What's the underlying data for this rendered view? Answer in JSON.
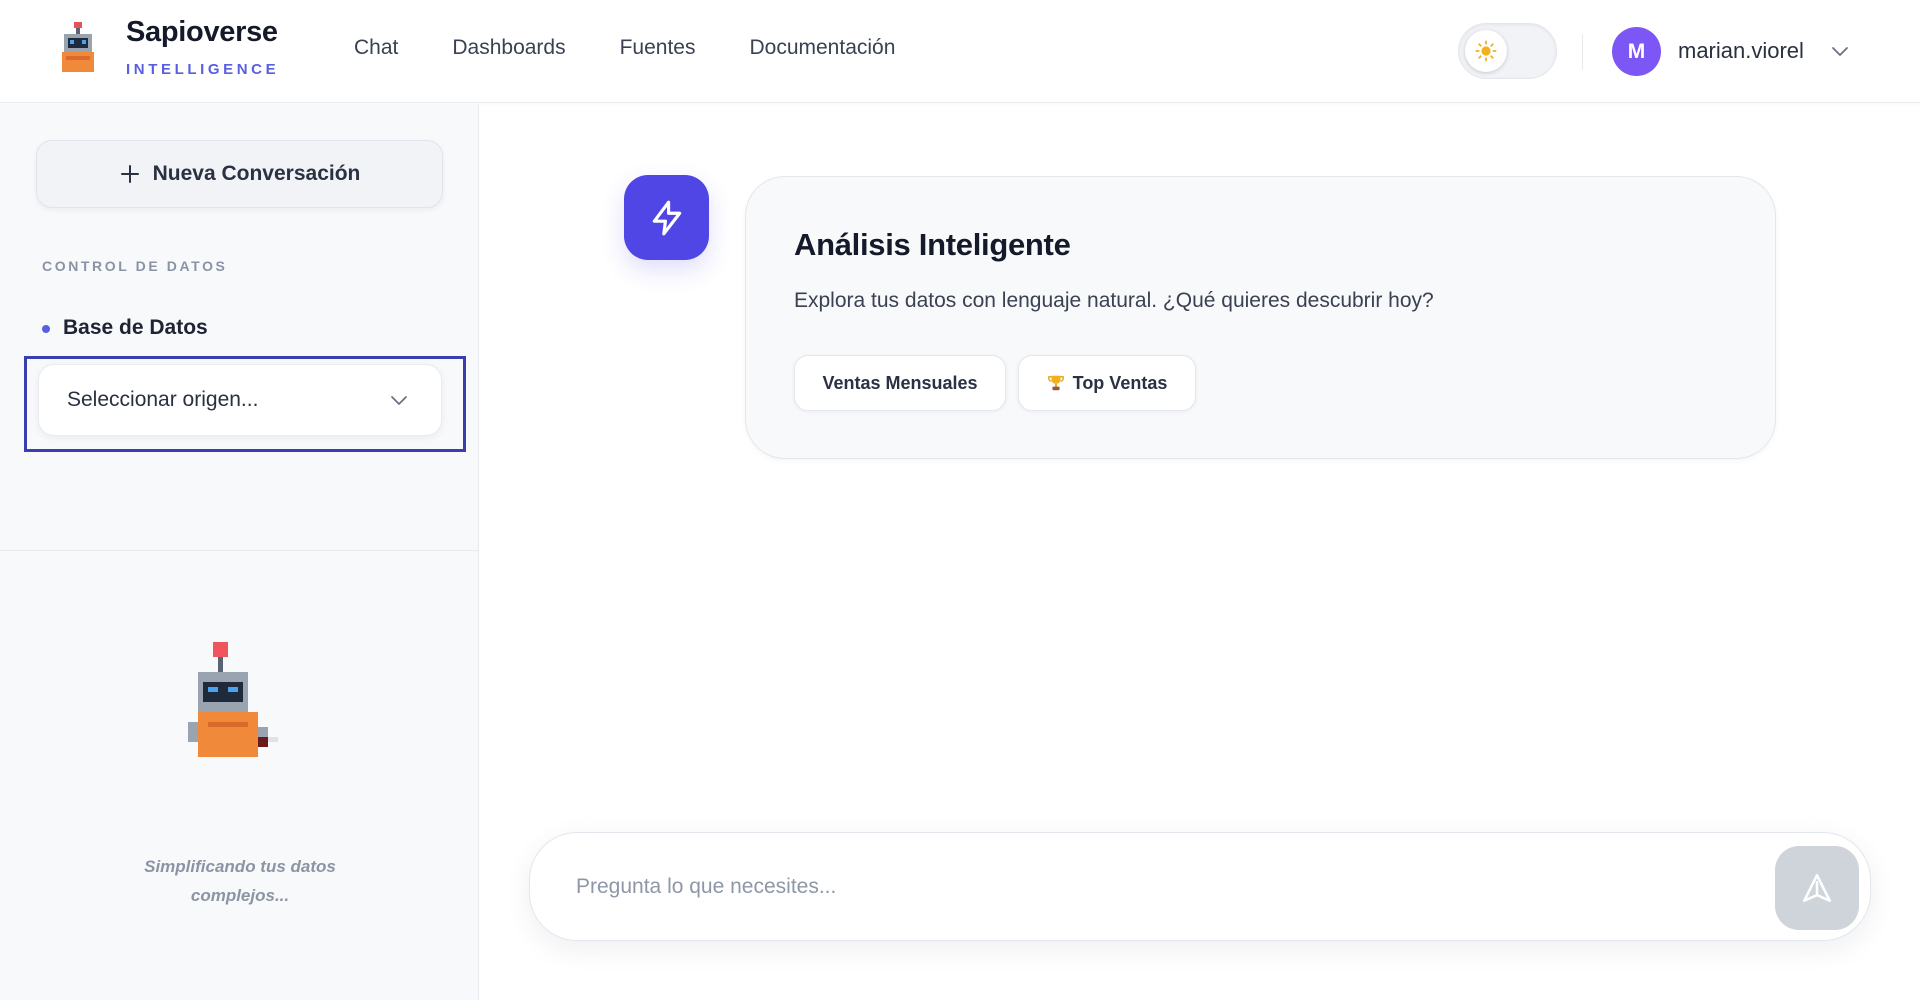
{
  "brand": {
    "name": "Sapioverse",
    "subtitle": "INTELLIGENCE"
  },
  "nav": {
    "items": [
      {
        "label": "Chat"
      },
      {
        "label": "Dashboards"
      },
      {
        "label": "Fuentes"
      },
      {
        "label": "Documentación"
      }
    ]
  },
  "user": {
    "initial": "M",
    "name": "marian.viorel"
  },
  "theme": {
    "mode": "light"
  },
  "sidebar": {
    "new_chat_label": "Nueva Conversación",
    "section_label": "CONTROL DE DATOS",
    "db_label": "Base de Datos",
    "select_value": "Seleccionar origen...",
    "tagline": "Simplificando tus datos complejos..."
  },
  "main": {
    "card": {
      "title": "Análisis Inteligente",
      "description": "Explora tus datos con lenguaje natural. ¿Qué quieres descubrir hoy?",
      "chips": [
        {
          "label": "Ventas Mensuales"
        },
        {
          "label": "Top Ventas",
          "icon": "trophy-icon"
        }
      ]
    },
    "composer": {
      "placeholder": "Pregunta lo que necesites..."
    }
  },
  "colors": {
    "accent": "#4f46e5",
    "brand_sub": "#5a5fe0",
    "avatar": "#7c57f5",
    "send_disabled": "#cfd3da"
  }
}
